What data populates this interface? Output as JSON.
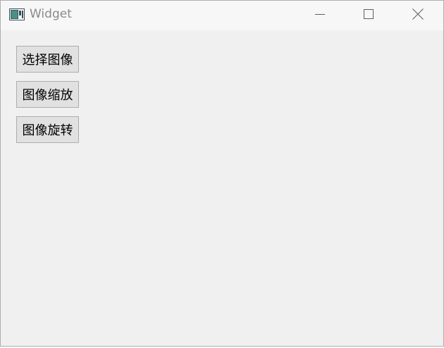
{
  "window": {
    "title": "Widget",
    "app_icon": "qt-widget-icon",
    "controls": {
      "minimize_icon": "minimize-icon",
      "maximize_icon": "maximize-icon",
      "close_icon": "close-icon"
    }
  },
  "buttons": [
    {
      "label": "选择图像"
    },
    {
      "label": "图像缩放"
    },
    {
      "label": "图像旋转"
    }
  ],
  "colors": {
    "titlebar": "#f7f7f7",
    "client": "#f0f0f0",
    "button_face": "#e1e1e1",
    "button_border": "#adadad",
    "title_text": "#8a8a8a"
  }
}
